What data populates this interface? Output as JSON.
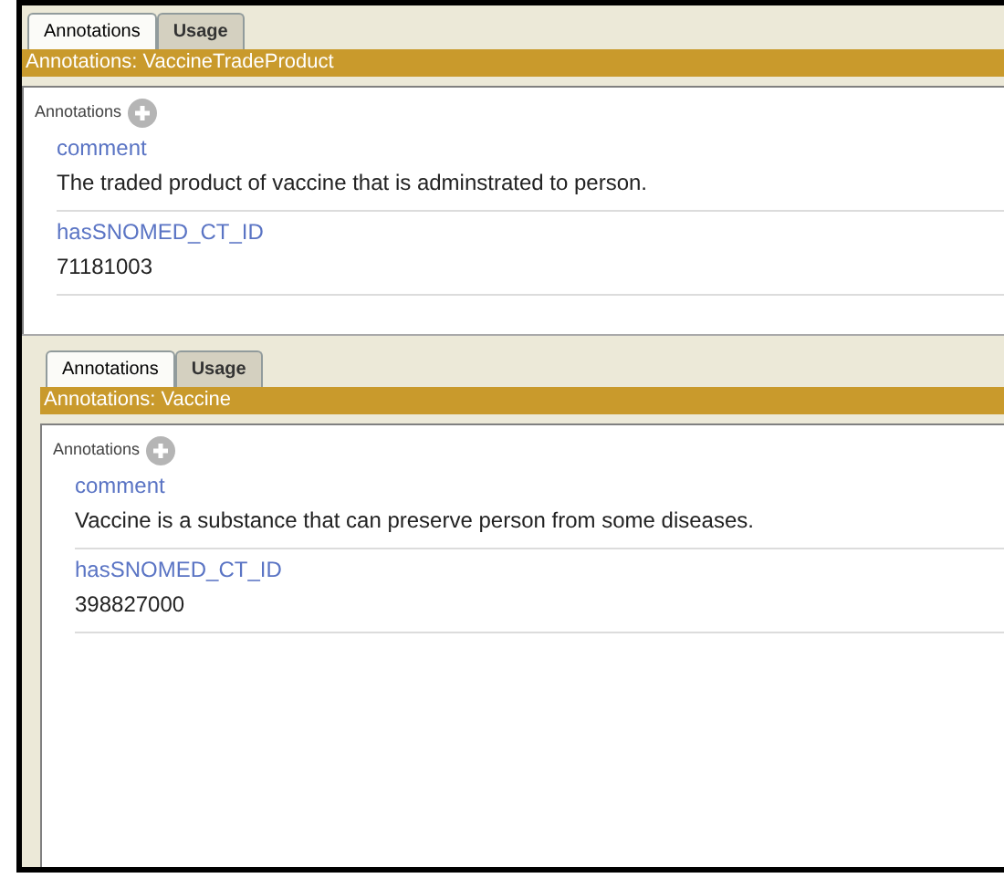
{
  "panels": [
    {
      "tabs": [
        {
          "label": "Annotations",
          "selected": true
        },
        {
          "label": "Usage",
          "selected": false
        }
      ],
      "title": "Annotations: VaccineTradeProduct",
      "section_label": "Annotations",
      "annotations": [
        {
          "property": "comment",
          "value": "The traded product of vaccine that is adminstrated to person."
        },
        {
          "property": "hasSNOMED_CT_ID",
          "value": "71181003"
        }
      ]
    },
    {
      "tabs": [
        {
          "label": "Annotations",
          "selected": true
        },
        {
          "label": "Usage",
          "selected": false
        }
      ],
      "title": "Annotations: Vaccine",
      "section_label": "Annotations",
      "annotations": [
        {
          "property": "comment",
          "value": "Vaccine is a substance that can preserve person from some diseases."
        },
        {
          "property": "hasSNOMED_CT_ID",
          "value": "398827000"
        }
      ]
    }
  ]
}
